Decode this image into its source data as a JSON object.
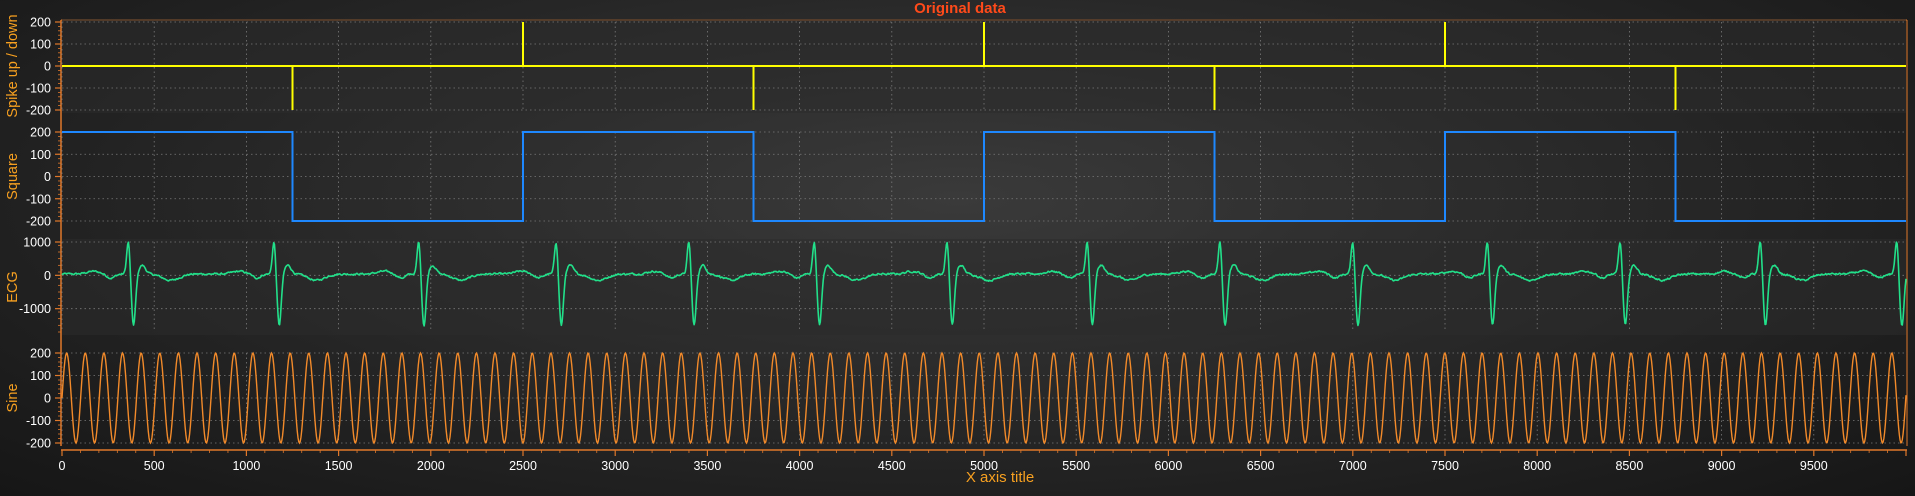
{
  "chart_data": {
    "type": "line",
    "title": "Original data",
    "xlabel": "X axis title",
    "xlim": [
      0,
      10000
    ],
    "x_ticks": [
      0,
      500,
      1000,
      1500,
      2000,
      2500,
      3000,
      3500,
      4000,
      4500,
      5000,
      5500,
      6000,
      6500,
      7000,
      7500,
      8000,
      8500,
      9000,
      9500
    ],
    "grid": true,
    "colors": {
      "title": "#ff4a1a",
      "axis_title": "#f7a020",
      "tick_label": "#ffffff",
      "axis_line": "#e0782a",
      "grid": "#7a7a7a",
      "panel_band": "#2c2c2c"
    },
    "panels": [
      {
        "ylabel": "Spike up / down",
        "ylim": [
          -200,
          200
        ],
        "y_ticks": [
          200,
          100,
          0,
          -100,
          -200
        ],
        "series": {
          "type": "spike",
          "color": "#ffff00",
          "baseline": 0,
          "spikes": [
            {
              "x": 1250,
              "y": -200
            },
            {
              "x": 2500,
              "y": 200
            },
            {
              "x": 3750,
              "y": -200
            },
            {
              "x": 5000,
              "y": 200
            },
            {
              "x": 6250,
              "y": -200
            },
            {
              "x": 7500,
              "y": 200
            },
            {
              "x": 8750,
              "y": -200
            }
          ]
        }
      },
      {
        "ylabel": "Square",
        "ylim": [
          -200,
          200
        ],
        "y_ticks": [
          200,
          100,
          0,
          -100,
          -200
        ],
        "series": {
          "type": "step",
          "color": "#1e88ff",
          "points": [
            [
              0,
              200
            ],
            [
              1250,
              200
            ],
            [
              1250,
              -200
            ],
            [
              2500,
              -200
            ],
            [
              2500,
              200
            ],
            [
              3750,
              200
            ],
            [
              3750,
              -200
            ],
            [
              5000,
              -200
            ],
            [
              5000,
              200
            ],
            [
              6250,
              200
            ],
            [
              6250,
              -200
            ],
            [
              7500,
              -200
            ],
            [
              7500,
              200
            ],
            [
              8750,
              200
            ],
            [
              8750,
              -200
            ],
            [
              10000,
              -200
            ]
          ]
        }
      },
      {
        "ylabel": "ECG",
        "ylim": [
          -1700,
          1000
        ],
        "y_ticks": [
          1000,
          0,
          -1000
        ],
        "series": {
          "type": "ecg",
          "color": "#22e08a",
          "r_peak_x": [
            360,
            1150,
            1935,
            2680,
            3400,
            4080,
            4800,
            5560,
            6280,
            7000,
            7730,
            8450,
            9210,
            9950
          ],
          "r_peak_value": 1000,
          "s_trough_value": -1550
        }
      },
      {
        "ylabel": "Sine",
        "ylim": [
          -200,
          200
        ],
        "y_ticks": [
          200,
          100,
          0,
          -100,
          -200
        ],
        "series": {
          "type": "sine",
          "color": "#f28a2a",
          "amplitude": 200,
          "period": 101,
          "phase": 0
        }
      }
    ]
  }
}
